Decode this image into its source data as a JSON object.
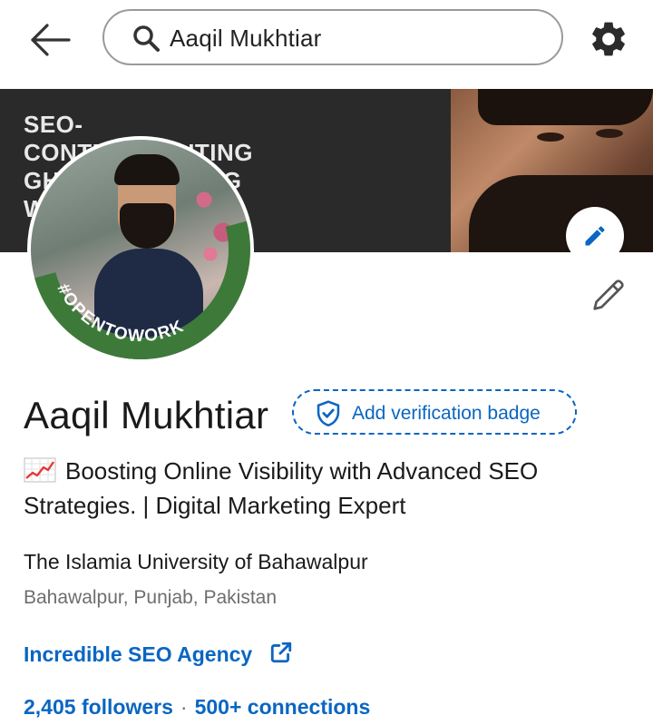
{
  "search": {
    "query": "Aaqil Mukhtiar"
  },
  "banner": {
    "text": "SEO-\nCONTENT WRITING\nGHOSTBLOGGING\nWEB DEVELOPER"
  },
  "avatar": {
    "frame_text": "#OPENTOWORK",
    "frame_color": "#3d7a3a"
  },
  "profile": {
    "name": "Aaqil Mukhtiar",
    "verify_label": "Add verification badge",
    "headline": "Boosting Online Visibility with Advanced SEO Strategies. | Digital Marketing Expert",
    "headline_emoji": "chart-increasing-icon",
    "university": "The Islamia University of Bahawalpur",
    "location": "Bahawalpur, Punjab, Pakistan",
    "website": "Incredible SEO Agency",
    "followers": "2,405 followers",
    "separator": "·",
    "connections": "500+ connections"
  },
  "colors": {
    "link": "#0a66c2",
    "banner_bg": "#2a2a2a",
    "secondary_text": "#6e6e6e"
  }
}
